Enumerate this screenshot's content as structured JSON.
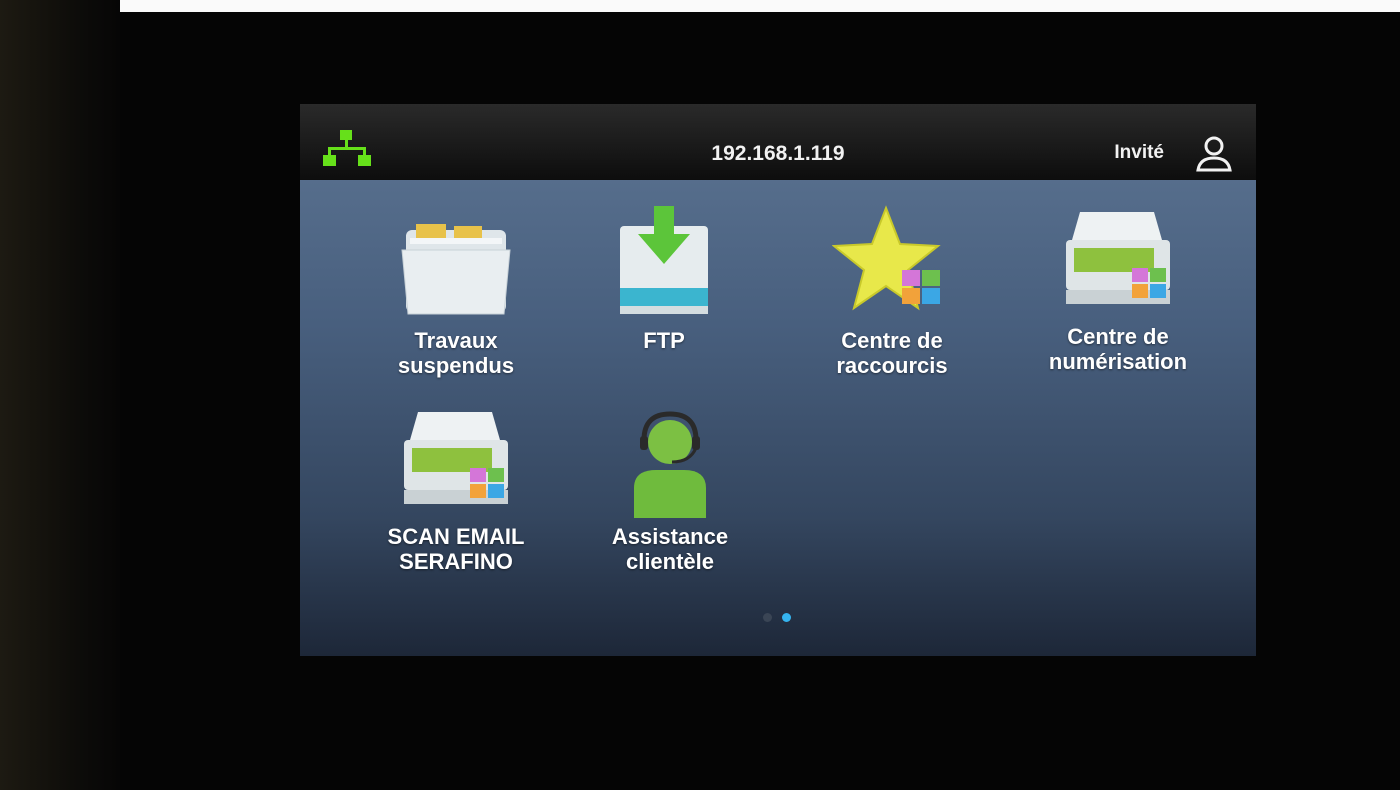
{
  "status_bar": {
    "network_icon": "network-icon",
    "ip_address": "192.168.1.119",
    "user_label": "Invité",
    "user_icon": "user-icon",
    "network_color": "#66e01a"
  },
  "apps": [
    {
      "label": "Travaux\nsuspendus",
      "icon": "folder-icon"
    },
    {
      "label": "FTP",
      "icon": "ftp-download-icon"
    },
    {
      "label": "Centre de\nraccourcis",
      "icon": "star-shortcut-icon"
    },
    {
      "label": "Centre de\nnumérisation",
      "icon": "scanner-icon"
    },
    {
      "label": "SCAN EMAIL\nSERAFINO",
      "icon": "scanner-icon"
    },
    {
      "label": "Assistance\nclientèle",
      "icon": "headset-person-icon"
    }
  ],
  "pagination": {
    "pages": 2,
    "current": 2,
    "active_color": "#35b4f0"
  }
}
